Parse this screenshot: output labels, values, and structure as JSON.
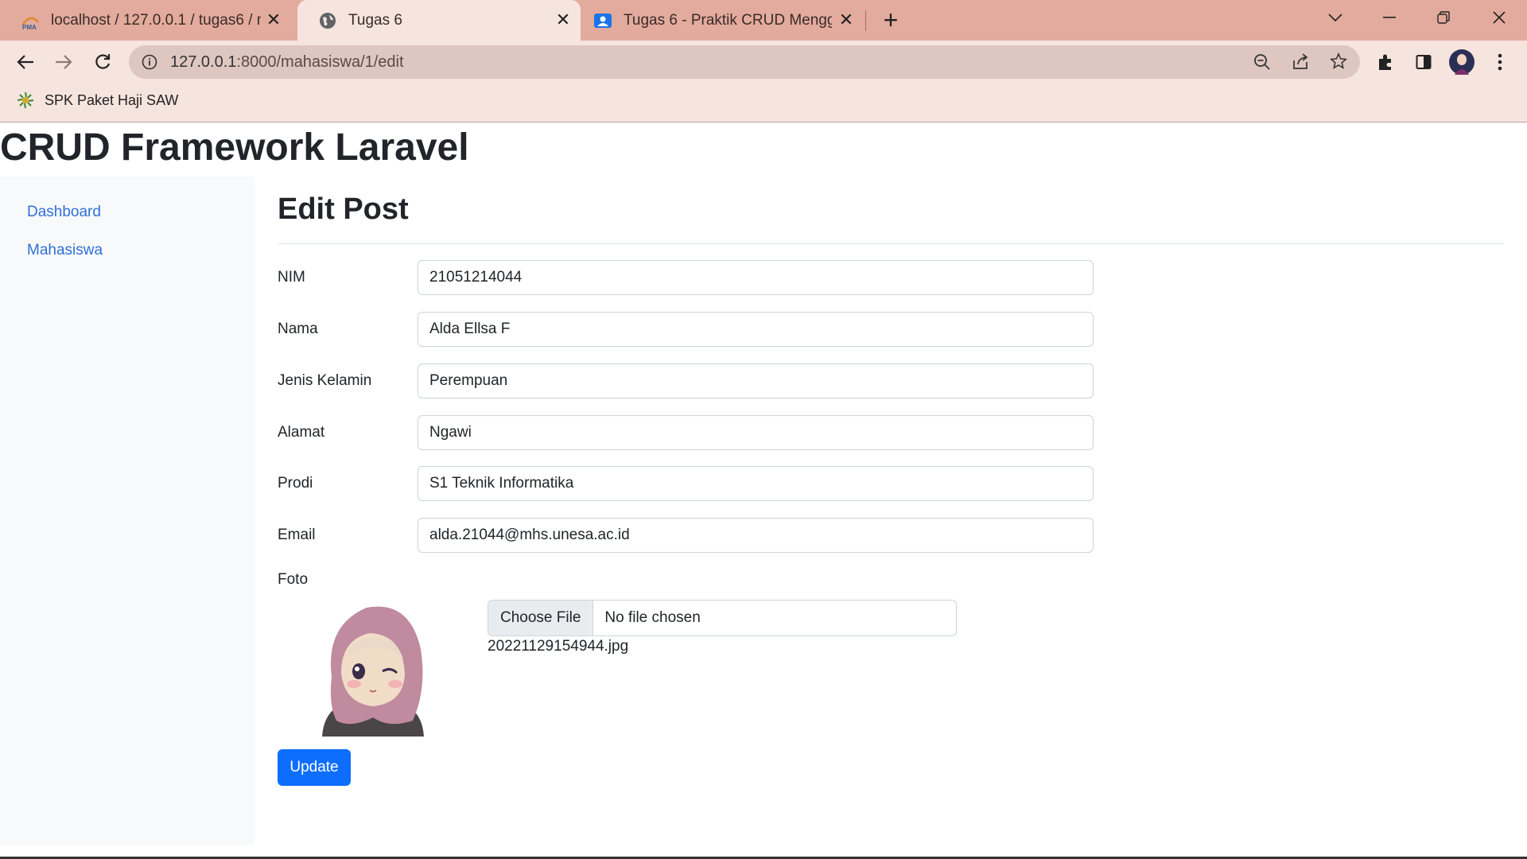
{
  "browser": {
    "tabs": [
      {
        "title": "localhost / 127.0.0.1 / tugas6 / m"
      },
      {
        "title": "Tugas 6"
      },
      {
        "title": "Tugas 6 - Praktik CRUD Menggu"
      }
    ],
    "address": {
      "host": "127.0.0.1",
      "path": ":8000/mahasiswa/1/edit"
    },
    "bookmarks": [
      {
        "label": "SPK Paket Haji SAW"
      }
    ],
    "colors": {
      "tabstrip": "#e3ab9d",
      "toolbar": "#f6e4df",
      "omnibox": "#dfc7c1"
    }
  },
  "app": {
    "title": "CRUD Framework Laravel"
  },
  "sidebar": {
    "items": [
      {
        "label": "Dashboard"
      },
      {
        "label": "Mahasiswa"
      }
    ]
  },
  "form": {
    "heading": "Edit Post",
    "fields": [
      {
        "label": "NIM",
        "value": "21051214044"
      },
      {
        "label": "Nama",
        "value": "Alda Ellsa F"
      },
      {
        "label": "Jenis Kelamin",
        "value": "Perempuan"
      },
      {
        "label": "Alamat",
        "value": "Ngawi"
      },
      {
        "label": "Prodi",
        "value": "S1 Teknik Informatika"
      },
      {
        "label": "Email",
        "value": "alda.21044@mhs.unesa.ac.id"
      }
    ],
    "photo": {
      "label": "Foto",
      "choose_label": "Choose File",
      "status": "No file chosen",
      "current_file": "20221129154944.jpg"
    },
    "submit_label": "Update"
  },
  "colors": {
    "primary": "#0d6efd",
    "link": "#2f6fd8",
    "sidebar_bg": "#f8f9fa"
  }
}
